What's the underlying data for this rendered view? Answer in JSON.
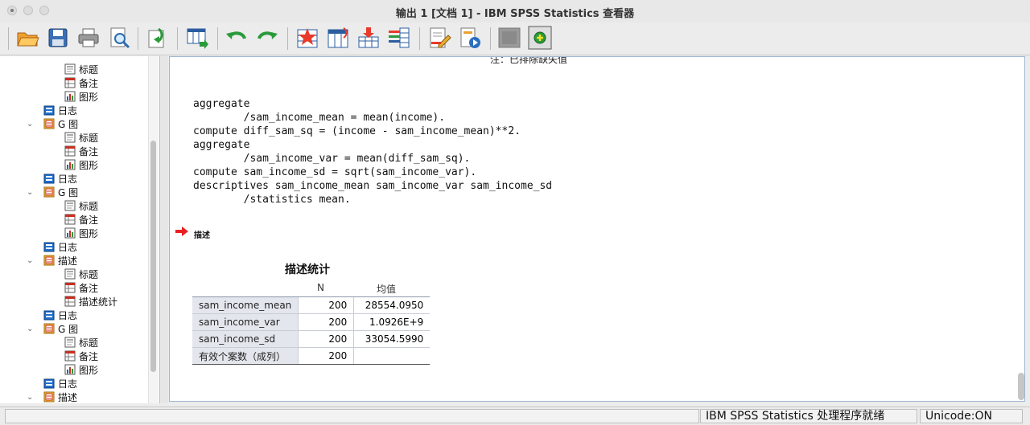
{
  "window": {
    "title": "输出 1 [文档 1] - IBM SPSS Statistics 查看器"
  },
  "toolbar": {
    "buttons": [
      "open-folder-icon",
      "save-icon",
      "print-icon",
      "print-preview-icon",
      "export-icon",
      "goto-data-icon",
      "undo-icon",
      "redo-icon",
      "goto-case-icon",
      "goto-variable-icon",
      "insert-cases-icon",
      "variables-icon",
      "designate-window-icon",
      "promote-icon",
      "hide-icon",
      "show-icon"
    ]
  },
  "outline": {
    "items": [
      {
        "label": "标题",
        "icon": "title-icon"
      },
      {
        "label": "备注",
        "icon": "notes-icon"
      },
      {
        "label": "图形",
        "icon": "chart-icon"
      },
      {
        "label": "日志",
        "icon": "log-icon"
      },
      {
        "label": "G 图",
        "icon": "procedure-icon",
        "expanded": true
      },
      {
        "label": "标题",
        "icon": "title-icon"
      },
      {
        "label": "备注",
        "icon": "notes-icon"
      },
      {
        "label": "图形",
        "icon": "chart-icon"
      },
      {
        "label": "日志",
        "icon": "log-icon"
      },
      {
        "label": "G 图",
        "icon": "procedure-icon",
        "expanded": true
      },
      {
        "label": "标题",
        "icon": "title-icon"
      },
      {
        "label": "备注",
        "icon": "notes-icon"
      },
      {
        "label": "图形",
        "icon": "chart-icon"
      },
      {
        "label": "日志",
        "icon": "log-icon"
      },
      {
        "label": "描述",
        "icon": "procedure-icon",
        "expanded": true
      },
      {
        "label": "标题",
        "icon": "title-icon"
      },
      {
        "label": "备注",
        "icon": "notes-icon"
      },
      {
        "label": "描述统计",
        "icon": "table-icon"
      },
      {
        "label": "日志",
        "icon": "log-icon"
      },
      {
        "label": "G 图",
        "icon": "procedure-icon",
        "expanded": true
      },
      {
        "label": "标题",
        "icon": "title-icon"
      },
      {
        "label": "备注",
        "icon": "notes-icon"
      },
      {
        "label": "图形",
        "icon": "chart-icon"
      },
      {
        "label": "日志",
        "icon": "log-icon"
      },
      {
        "label": "描述",
        "icon": "procedure-icon",
        "expanded": true
      }
    ]
  },
  "content": {
    "note": "注：已排除缺失值",
    "syntax": "aggregate\n        /sam_income_mean = mean(income).\ncompute diff_sam_sq = (income - sam_income_mean)**2.\naggregate\n        /sam_income_var = mean(diff_sam_sq).\ncompute sam_income_sd = sqrt(sam_income_var).\ndescriptives sam_income_mean sam_income_var sam_income_sd\n        /statistics mean.",
    "section_label": "描述",
    "table": {
      "title": "描述统计",
      "col_n": "N",
      "col_mean": "均值",
      "rows": [
        {
          "label": "sam_income_mean",
          "n": "200",
          "mean": "28554.0950"
        },
        {
          "label": "sam_income_var",
          "n": "200",
          "mean": "1.0926E+9"
        },
        {
          "label": "sam_income_sd",
          "n": "200",
          "mean": "33054.5990"
        },
        {
          "label": "有效个案数（成列）",
          "n": "200",
          "mean": ""
        }
      ]
    }
  },
  "status": {
    "processor": "IBM SPSS Statistics 处理程序就绪",
    "unicode": "Unicode:ON"
  }
}
